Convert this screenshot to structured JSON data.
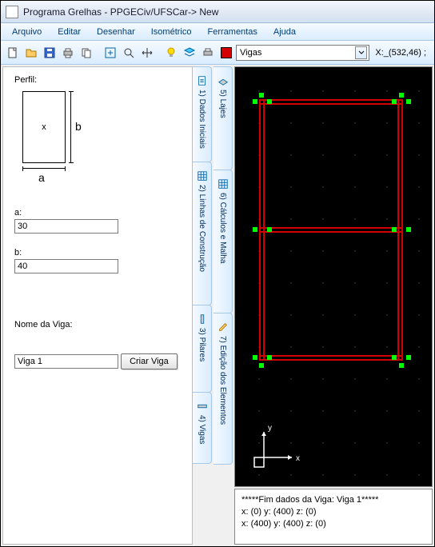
{
  "window": {
    "title": "Programa Grelhas - PPGECiv/UFSCar-> New"
  },
  "menu": {
    "arquivo": "Arquivo",
    "editar": "Editar",
    "desenhar": "Desenhar",
    "isometrico": "Isométrico",
    "ferramentas": "Ferramentas",
    "ajuda": "Ajuda"
  },
  "layer": {
    "selected": "Vigas"
  },
  "coords": {
    "readout": "X:_(532,46) ;"
  },
  "panel": {
    "perfil_label": "Perfil:",
    "x_mark": "x",
    "dim_a": "a",
    "dim_b": "b",
    "label_a": "a:",
    "value_a": "30",
    "label_b": "b:",
    "value_b": "40",
    "label_nome": "Nome da Viga:",
    "value_nome": "Viga 1",
    "btn_criar": "Criar Viga"
  },
  "tabs_col1": [
    {
      "label": "1) Dados Iniciais"
    },
    {
      "label": "2) Linhas de Construção"
    },
    {
      "label": "3) Pilares"
    },
    {
      "label": "4) Vigas"
    }
  ],
  "tabs_col2": [
    {
      "label": "5) Lajes"
    },
    {
      "label": "6) Cálculos e Malha"
    },
    {
      "label": "7) Edição dos Elementos"
    }
  ],
  "console": {
    "line1": "*****Fim dados da Viga: Viga 1*****",
    "line2": "x: (0)  y: (400) z: (0)",
    "line3": "x: (400)  y: (400) z: (0)"
  }
}
